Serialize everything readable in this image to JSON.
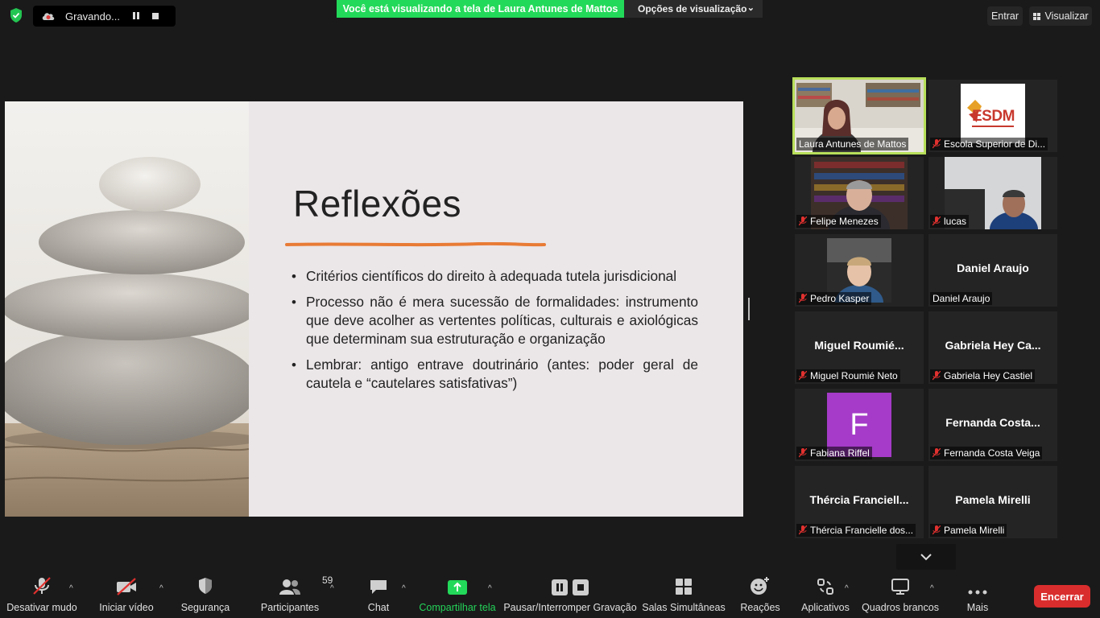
{
  "top_bar": {
    "recording_label": "Gravando...",
    "viewing_banner": "Você está visualizando a tela de Laura Antunes de Mattos",
    "view_options_label": "Opções de visualização",
    "enter_label": "Entrar",
    "view_label": "Visualizar"
  },
  "slide": {
    "title": "Reflexões",
    "bullets": [
      "Critérios científicos do direito à adequada tutela jurisdicional",
      "Processo não é mera sucessão de formalidades: instrumento que deve acolher as vertentes políticas, culturais e axiológicas que determinam sua estruturação e organização",
      "Lembrar: antigo entrave doutrinário (antes: poder geral de cautela e “cautelares satisfativas”)"
    ],
    "accent_color": "#e87b35"
  },
  "participants": [
    {
      "name": "Laura Antunes de Mattos",
      "muted": false,
      "active": true,
      "kind": "video"
    },
    {
      "name": "Escola Superior de Di...",
      "muted": true,
      "kind": "logo",
      "logo_text": "ESDM"
    },
    {
      "name": "Felipe Menezes",
      "muted": true,
      "kind": "video"
    },
    {
      "name": "lucas",
      "muted": true,
      "kind": "video"
    },
    {
      "name": "Pedro Kasper",
      "muted": true,
      "kind": "video"
    },
    {
      "name": "Daniel Araujo",
      "muted": false,
      "kind": "name",
      "big_name": "Daniel Araujo"
    },
    {
      "name": "Miguel Roumié Neto",
      "muted": true,
      "kind": "name",
      "big_name": "Miguel  Roumié..."
    },
    {
      "name": "Gabriela Hey Castiel",
      "muted": true,
      "kind": "name",
      "big_name": "Gabriela  Hey  Ca..."
    },
    {
      "name": "Fabiana Riffel",
      "muted": true,
      "kind": "avatar",
      "avatar_letter": "F",
      "avatar_color": "#a53bc8"
    },
    {
      "name": "Fernanda Costa Veiga",
      "muted": true,
      "kind": "name",
      "big_name": "Fernanda  Costa..."
    },
    {
      "name": "Thércia Francielle dos...",
      "muted": true,
      "kind": "name",
      "big_name": "Thércia  Franciell..."
    },
    {
      "name": "Pamela Mirelli",
      "muted": true,
      "kind": "name",
      "big_name": "Pamela Mirelli"
    }
  ],
  "toolbar": {
    "unmute": "Desativar mudo",
    "start_video": "Iniciar vídeo",
    "security": "Segurança",
    "participants": "Participantes",
    "participants_count": "59",
    "chat": "Chat",
    "share_screen": "Compartilhar tela",
    "pause_stop_recording": "Pausar/Interromper Gravação",
    "breakout_rooms": "Salas Simultâneas",
    "reactions": "Reações",
    "apps": "Aplicativos",
    "whiteboards": "Quadros brancos",
    "more": "Mais",
    "end": "Encerrar"
  }
}
